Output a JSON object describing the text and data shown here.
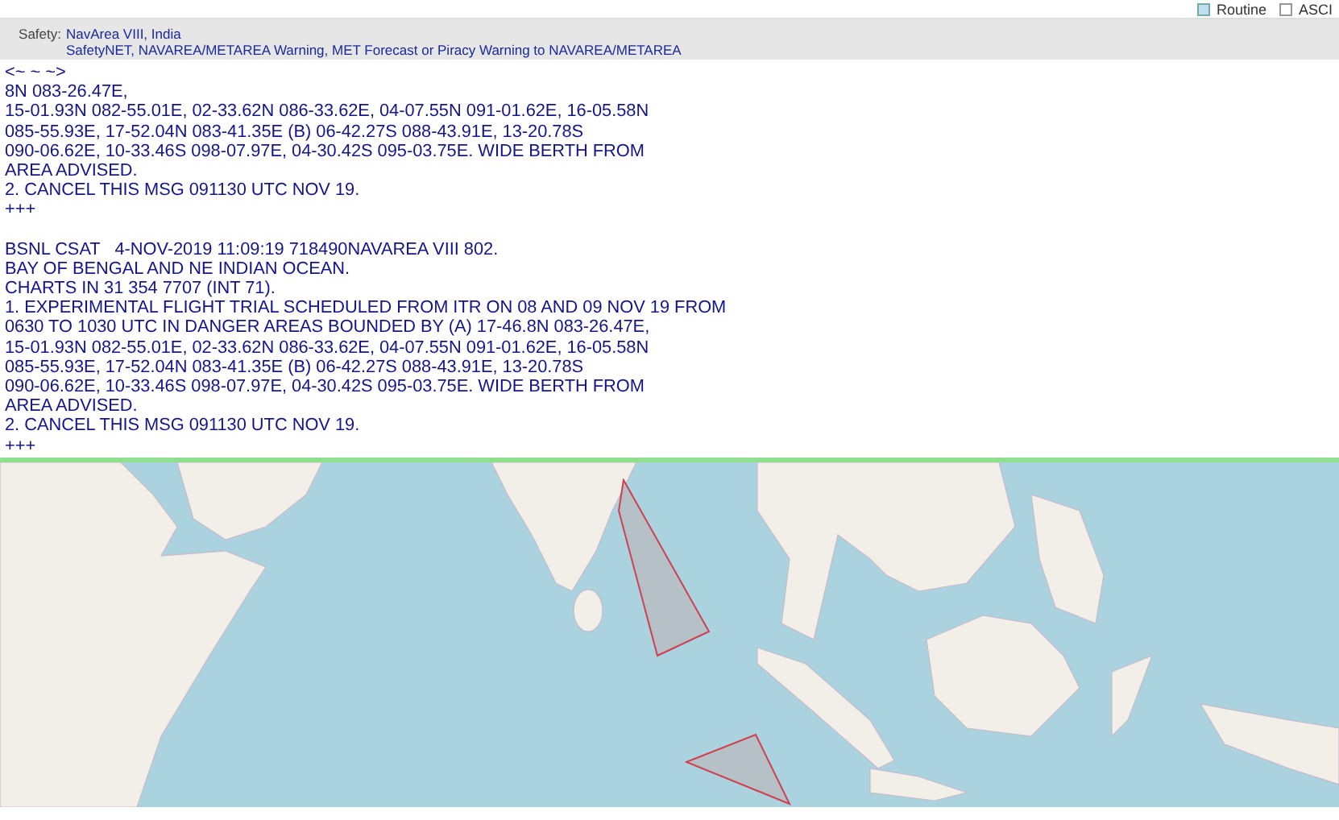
{
  "options": [
    {
      "label": "Routine",
      "checked": true
    },
    {
      "label": "ASCI",
      "checked": false
    }
  ],
  "safety": {
    "label": "Safety:",
    "area": "NavArea VIII, India",
    "category": "SafetyNET, NAVAREA/METAREA Warning, MET Forecast or Piracy Warning to NAVAREA/METAREA"
  },
  "messages": [
    {
      "lines": [
        "<~ ~ ~>",
        "8N 083-26.47E,",
        "15-01.93N 082-55.01E, 02-33.62N 086-33.62E, 04-07.55N 091-01.62E, 16-05.58N",
        "085-55.93E, 17-52.04N 083-41.35E (B) 06-42.27S 088-43.91E, 13-20.78S",
        "090-06.62E, 10-33.46S 098-07.97E, 04-30.42S 095-03.75E. WIDE BERTH FROM",
        "AREA ADVISED.",
        "2. CANCEL THIS MSG 091130 UTC NOV 19.",
        "+++"
      ]
    },
    {
      "lines": [
        "BSNL CSAT   4-NOV-2019 11:09:19 718490NAVAREA VIII 802.",
        "BAY OF BENGAL AND NE INDIAN OCEAN.",
        "CHARTS IN 31 354 7707 (INT 71).",
        "1. EXPERIMENTAL FLIGHT TRIAL SCHEDULED FROM ITR ON 08 AND 09 NOV 19 FROM",
        "0630 TO 1030 UTC IN DANGER AREAS BOUNDED BY (A) 17-46.8N 083-26.47E,",
        "15-01.93N 082-55.01E, 02-33.62N 086-33.62E, 04-07.55N 091-01.62E, 16-05.58N",
        "085-55.93E, 17-52.04N 083-41.35E (B) 06-42.27S 088-43.91E, 13-20.78S",
        "090-06.62E, 10-33.46S 098-07.97E, 04-30.42S 095-03.75E. WIDE BERTH FROM",
        "AREA ADVISED.",
        "2. CANCEL THIS MSG 091130 UTC NOV 19.",
        "+++"
      ]
    }
  ]
}
